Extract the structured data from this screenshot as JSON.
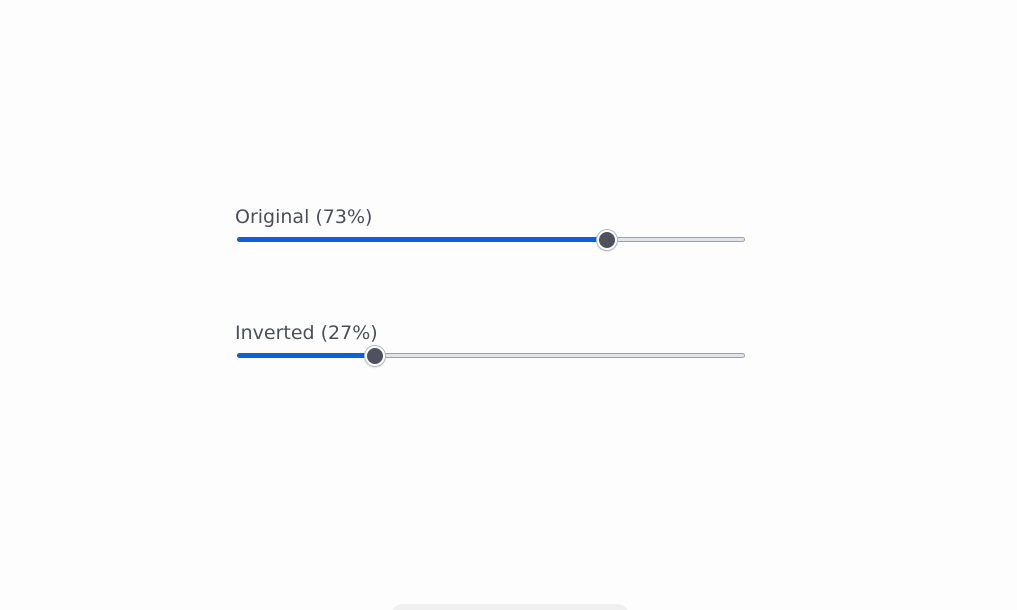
{
  "sliders": [
    {
      "label": "Original (73%)",
      "value": 0.73,
      "fill_color": "#0b62d6"
    },
    {
      "label": "Inverted (27%)",
      "value": 0.27,
      "fill_color": "#0b62d6"
    }
  ],
  "colors": {
    "accent": "#0b62d6",
    "track": "#e3e4ea",
    "thumb": "#4d525e",
    "label": "#4a4f5a"
  }
}
